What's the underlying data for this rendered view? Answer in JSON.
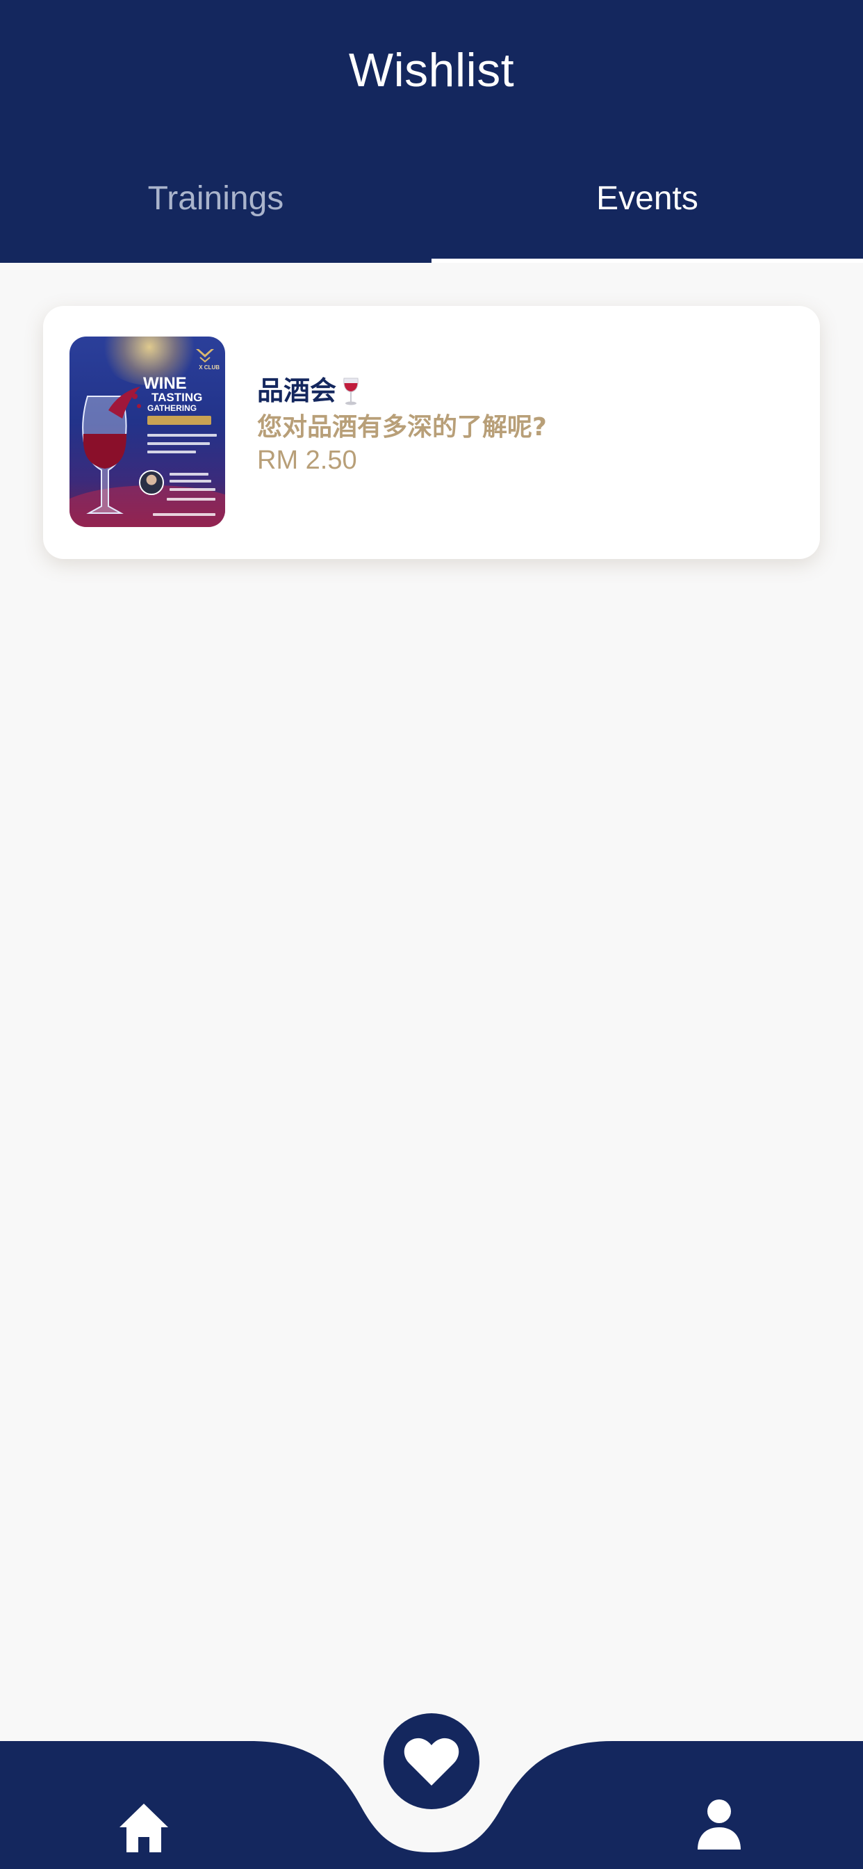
{
  "header": {
    "title": "Wishlist"
  },
  "tabs": [
    {
      "label": "Trainings",
      "active": false
    },
    {
      "label": "Events",
      "active": true
    }
  ],
  "wishlist_items": [
    {
      "title": "品酒会",
      "title_emoji": "🍷",
      "subtitle": "您对品酒有多深的了解呢?",
      "price": "RM 2.50",
      "thumbnail": {
        "line1": "WINE",
        "line2": "TASTING",
        "line3": "GATHERING",
        "brand": "X CLUB"
      }
    }
  ],
  "bottom_nav": {
    "items": [
      {
        "icon": "home-icon"
      },
      {
        "icon": "heart-icon",
        "selected": true
      },
      {
        "icon": "user-icon"
      }
    ]
  },
  "colors": {
    "primary": "#14275e",
    "accent": "#b89f78",
    "background": "#f8f8f8"
  }
}
